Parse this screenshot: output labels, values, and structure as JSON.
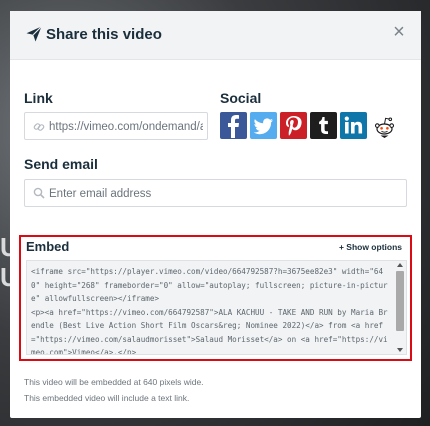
{
  "modal": {
    "title": "Share this video",
    "close_label": "×"
  },
  "link": {
    "label": "Link",
    "value": "https://vimeo.com/ondemand/a"
  },
  "social": {
    "label": "Social",
    "buttons": [
      {
        "name": "facebook",
        "glyph": "f",
        "color": "#3b5998"
      },
      {
        "name": "twitter",
        "glyph": "t",
        "color": "#55acee"
      },
      {
        "name": "pinterest",
        "glyph": "P",
        "color": "#cb2027"
      },
      {
        "name": "tumblr",
        "glyph": "t",
        "color": "#1e1e1e"
      },
      {
        "name": "linkedin",
        "glyph": "in",
        "color": "#0e76a8"
      },
      {
        "name": "reddit",
        "glyph": "reddit",
        "color": "#ff4500"
      }
    ]
  },
  "send_email": {
    "label": "Send email",
    "placeholder": "Enter email address"
  },
  "embed": {
    "label": "Embed",
    "show_options": "+ Show options",
    "code": "<iframe src=\"https://player.vimeo.com/video/664792587?h=3675ee82e3\" width=\"640\" height=\"268\" frameborder=\"0\" allow=\"autoplay; fullscreen; picture-in-picture\" allowfullscreen></iframe>\n<p><a href=\"https://vimeo.com/664792587\">ALA KACHUU - TAKE AND RUN by Maria Brendle (Best Live Action Short Film Oscars&reg; Nominee 2022)</a> from <a href=\"https://vimeo.com/salaudmorisset\">Salaud Morisset</a> on <a href=\"https://vimeo.com\">Vimeo</a>.</p>",
    "border_color": "#dc0a12"
  },
  "notes": [
    "This video will be embedded at 640 pixels wide.",
    "This embedded video will include a text link."
  ]
}
